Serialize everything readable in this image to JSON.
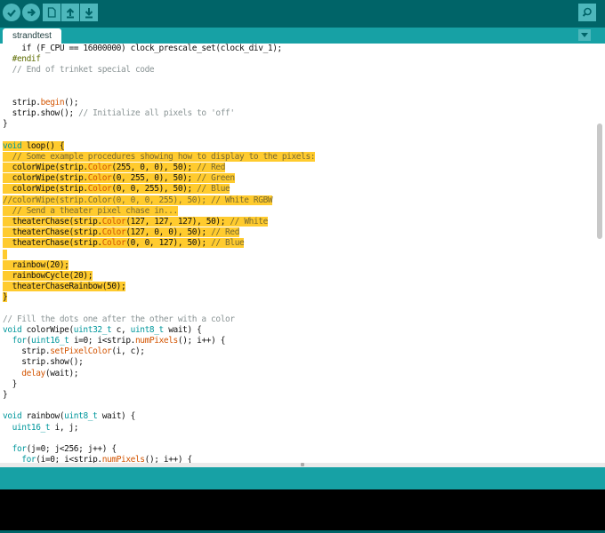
{
  "toolbar": {
    "buttons": [
      {
        "name": "verify",
        "icon": "checkmark-icon"
      },
      {
        "name": "upload",
        "icon": "arrow-right-icon"
      },
      {
        "name": "new",
        "icon": "new-file-icon"
      },
      {
        "name": "open",
        "icon": "arrow-up-icon"
      },
      {
        "name": "save",
        "icon": "arrow-down-icon"
      }
    ],
    "serial_monitor_icon": "magnifier-icon"
  },
  "tabs": [
    {
      "label": "strandtest",
      "active": true
    }
  ],
  "colors": {
    "toolbar": "#006468",
    "accent": "#17a1a5",
    "highlight": "#ffcb2e",
    "keyword": "#00979c",
    "function": "#d35400"
  },
  "editor": {
    "lines": [
      {
        "t": [
          [
            "    if (F_CPU == 16000000) clock_prescale_set(clock_div_1);",
            "tx"
          ]
        ]
      },
      {
        "t": [
          [
            "  ",
            "tx"
          ],
          [
            "#endif",
            "pp"
          ]
        ]
      },
      {
        "t": [
          [
            "  // End of trinket special code",
            "cm"
          ]
        ]
      },
      {
        "t": []
      },
      {
        "t": []
      },
      {
        "t": [
          [
            "  strip.",
            "tx"
          ],
          [
            "begin",
            "fn"
          ],
          [
            "();",
            "tx"
          ]
        ]
      },
      {
        "t": [
          [
            "  strip.show(); ",
            "tx"
          ],
          [
            "// Initialize all pixels to 'off'",
            "cm"
          ]
        ]
      },
      {
        "t": [
          [
            "}",
            "tx"
          ]
        ]
      },
      {
        "t": []
      },
      {
        "h": true,
        "t": [
          [
            "void",
            "kw"
          ],
          [
            " loop() {",
            "tx"
          ]
        ]
      },
      {
        "h": true,
        "t": [
          [
            "  // Some example procedures showing how to display to the pixels:",
            "cm"
          ]
        ]
      },
      {
        "h": true,
        "t": [
          [
            "  colorWipe(strip.",
            "tx"
          ],
          [
            "Color",
            "fn"
          ],
          [
            "(255, 0, 0), 50); ",
            "tx"
          ],
          [
            "// Red",
            "cm"
          ]
        ]
      },
      {
        "h": true,
        "t": [
          [
            "  colorWipe(strip.",
            "tx"
          ],
          [
            "Color",
            "fn"
          ],
          [
            "(0, 255, 0), 50); ",
            "tx"
          ],
          [
            "// Green",
            "cm"
          ]
        ]
      },
      {
        "h": true,
        "t": [
          [
            "  colorWipe(strip.",
            "tx"
          ],
          [
            "Color",
            "fn"
          ],
          [
            "(0, 0, 255), 50); ",
            "tx"
          ],
          [
            "// Blue",
            "cm"
          ]
        ]
      },
      {
        "h": true,
        "t": [
          [
            "//colorWipe(strip.Color(0, 0, 0, 255), 50); // White RGBW",
            "cm"
          ]
        ]
      },
      {
        "h": true,
        "t": [
          [
            "  // Send a theater pixel chase in...",
            "cm"
          ]
        ]
      },
      {
        "h": true,
        "t": [
          [
            "  theaterChase(strip.",
            "tx"
          ],
          [
            "Color",
            "fn"
          ],
          [
            "(127, 127, 127), 50); ",
            "tx"
          ],
          [
            "// White",
            "cm"
          ]
        ]
      },
      {
        "h": true,
        "t": [
          [
            "  theaterChase(strip.",
            "tx"
          ],
          [
            "Color",
            "fn"
          ],
          [
            "(127, 0, 0), 50); ",
            "tx"
          ],
          [
            "// Red",
            "cm"
          ]
        ]
      },
      {
        "h": true,
        "t": [
          [
            "  theaterChase(strip.",
            "tx"
          ],
          [
            "Color",
            "fn"
          ],
          [
            "(0, 0, 127), 50); ",
            "tx"
          ],
          [
            "// Blue",
            "cm"
          ]
        ]
      },
      {
        "h": true,
        "t": [
          [
            " ",
            "tx"
          ]
        ]
      },
      {
        "h": true,
        "t": [
          [
            "  rainbow(20);",
            "tx"
          ]
        ]
      },
      {
        "h": true,
        "t": [
          [
            "  rainbowCycle(20);",
            "tx"
          ]
        ]
      },
      {
        "h": true,
        "t": [
          [
            "  theaterChaseRainbow(50);",
            "tx"
          ]
        ]
      },
      {
        "h": true,
        "t": [
          [
            "}",
            "tx"
          ]
        ]
      },
      {
        "t": []
      },
      {
        "t": [
          [
            "// Fill the dots one after the other with a color",
            "cm"
          ]
        ]
      },
      {
        "t": [
          [
            "void",
            "kw"
          ],
          [
            " colorWipe(",
            "tx"
          ],
          [
            "uint32_t",
            "kw"
          ],
          [
            " c, ",
            "tx"
          ],
          [
            "uint8_t",
            "kw"
          ],
          [
            " wait) {",
            "tx"
          ]
        ]
      },
      {
        "t": [
          [
            "  ",
            "tx"
          ],
          [
            "for",
            "kw"
          ],
          [
            "(",
            "tx"
          ],
          [
            "uint16_t",
            "kw"
          ],
          [
            " i=0; i<strip.",
            "tx"
          ],
          [
            "numPixels",
            "fn"
          ],
          [
            "(); i++) {",
            "tx"
          ]
        ]
      },
      {
        "t": [
          [
            "    strip.",
            "tx"
          ],
          [
            "setPixelColor",
            "fn"
          ],
          [
            "(i, c);",
            "tx"
          ]
        ]
      },
      {
        "t": [
          [
            "    strip.show();",
            "tx"
          ]
        ]
      },
      {
        "t": [
          [
            "    ",
            "tx"
          ],
          [
            "delay",
            "fn"
          ],
          [
            "(wait);",
            "tx"
          ]
        ]
      },
      {
        "t": [
          [
            "  }",
            "tx"
          ]
        ]
      },
      {
        "t": [
          [
            "}",
            "tx"
          ]
        ]
      },
      {
        "t": []
      },
      {
        "t": [
          [
            "void",
            "kw"
          ],
          [
            " rainbow(",
            "tx"
          ],
          [
            "uint8_t",
            "kw"
          ],
          [
            " wait) {",
            "tx"
          ]
        ]
      },
      {
        "t": [
          [
            "  ",
            "tx"
          ],
          [
            "uint16_t",
            "kw"
          ],
          [
            " i, j;",
            "tx"
          ]
        ]
      },
      {
        "t": []
      },
      {
        "t": [
          [
            "  ",
            "tx"
          ],
          [
            "for",
            "kw"
          ],
          [
            "(j=0; j<256; j++) {",
            "tx"
          ]
        ]
      },
      {
        "t": [
          [
            "    ",
            "tx"
          ],
          [
            "for",
            "kw"
          ],
          [
            "(i=0; i<strip.",
            "tx"
          ],
          [
            "numPixels",
            "fn"
          ],
          [
            "(); i++) {",
            "tx"
          ]
        ]
      }
    ]
  }
}
